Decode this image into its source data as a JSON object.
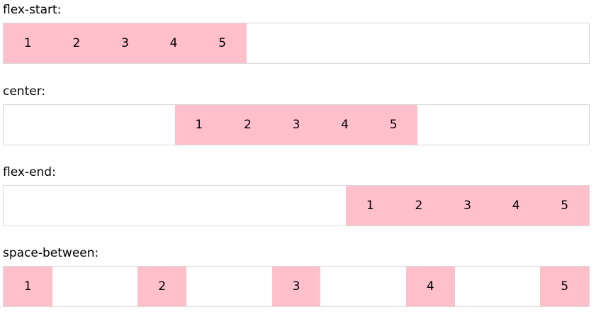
{
  "demos": [
    {
      "label": "flex-start:",
      "items": [
        "1",
        "2",
        "3",
        "4",
        "5"
      ]
    },
    {
      "label": "center:",
      "items": [
        "1",
        "2",
        "3",
        "4",
        "5"
      ]
    },
    {
      "label": "flex-end:",
      "items": [
        "1",
        "2",
        "3",
        "4",
        "5"
      ]
    },
    {
      "label": "space-between:",
      "items": [
        "1",
        "2",
        "3",
        "4",
        "5"
      ]
    }
  ],
  "colors": {
    "item_background": "#ffc0cb",
    "container_border": "#d9d9d9"
  }
}
